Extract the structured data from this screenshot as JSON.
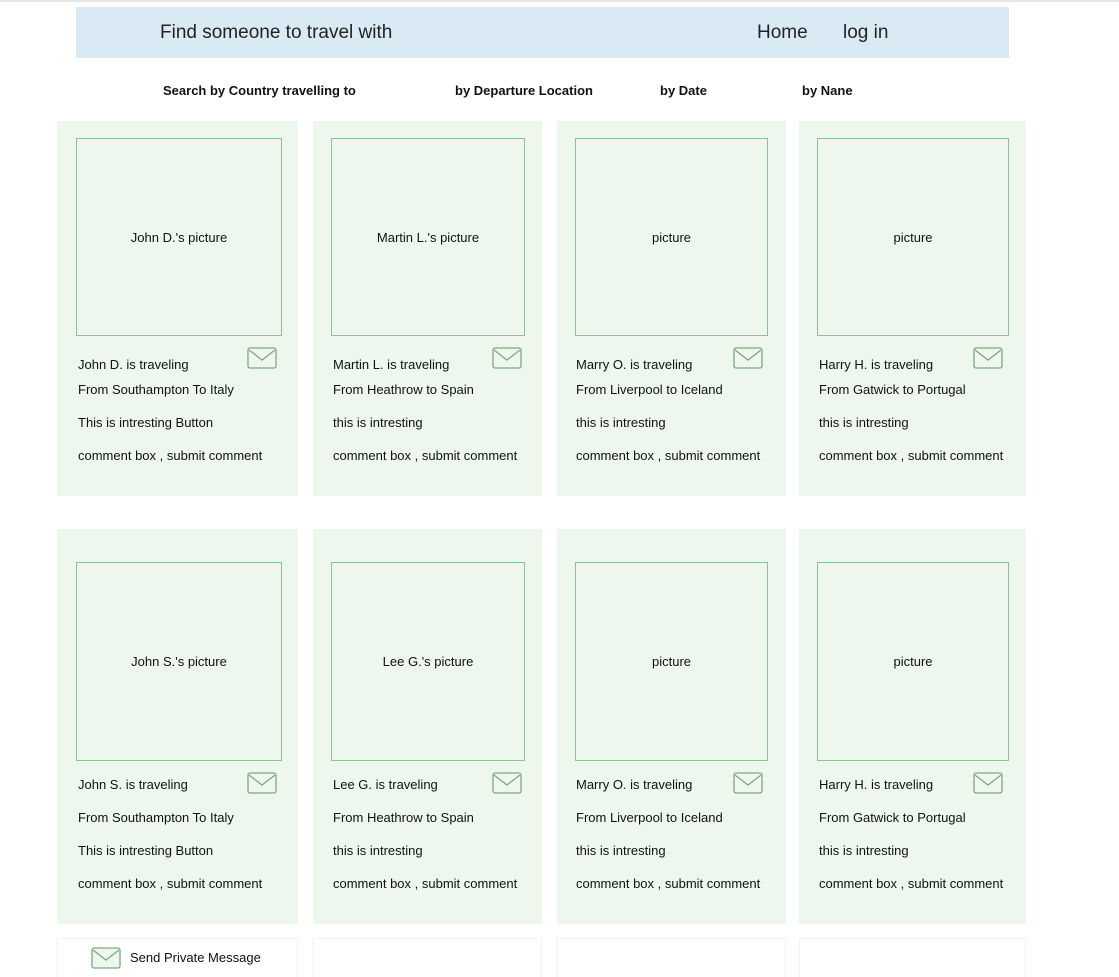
{
  "header": {
    "title": "Find someone to travel with",
    "home": "Home",
    "login": "log in"
  },
  "search": {
    "country": "Search by  Country  travelling to",
    "departure": "by Departure Location",
    "date": "by Date",
    "name": "by Nane"
  },
  "cards": [
    {
      "picture": "John D.'s picture",
      "line1": "John D. is traveling",
      "line2": "From Southampton To Italy",
      "line3": "This is intresting Button",
      "line4": "comment box , submit comment"
    },
    {
      "picture": "Martin L.'s picture",
      "line1": "Martin L. is traveling",
      "line2": "From Heathrow to Spain",
      "line3": "this is intresting",
      "line4": "comment box , submit comment"
    },
    {
      "picture": "picture",
      "line1": "Marry O. is traveling",
      "line2": "From Liverpool to Iceland",
      "line3": "this is intresting",
      "line4": "comment box , submit comment"
    },
    {
      "picture": "picture",
      "line1": "Harry H. is traveling",
      "line2": "From Gatwick to Portugal",
      "line3": "this is intresting",
      "line4": "comment box , submit comment"
    },
    {
      "picture": "John S.'s picture",
      "line1": "John S. is traveling",
      "line2": "From Southampton To Italy",
      "line3": "This is intresting Button",
      "line4": "comment box , submit comment"
    },
    {
      "picture": "Lee G.'s picture",
      "line1": "Lee G. is traveling",
      "line2": "From Heathrow to Spain",
      "line3": "this is intresting",
      "line4": "comment box , submit comment"
    },
    {
      "picture": "picture",
      "line1": "Marry O. is traveling",
      "line2": "From Liverpool to Iceland",
      "line3": "this is intresting",
      "line4": "comment box , submit comment"
    },
    {
      "picture": "picture",
      "line1": "Harry H. is traveling",
      "line2": "From Gatwick to Portugal",
      "line3": "this is intresting",
      "line4": "comment box , submit comment"
    }
  ],
  "legend": {
    "icon": "envelope-icon",
    "label": "Send Private Message"
  },
  "colors": {
    "header_bg": "#daeaf5",
    "card_bg": "#edf7ee",
    "picture_border": "#8fc08f"
  }
}
